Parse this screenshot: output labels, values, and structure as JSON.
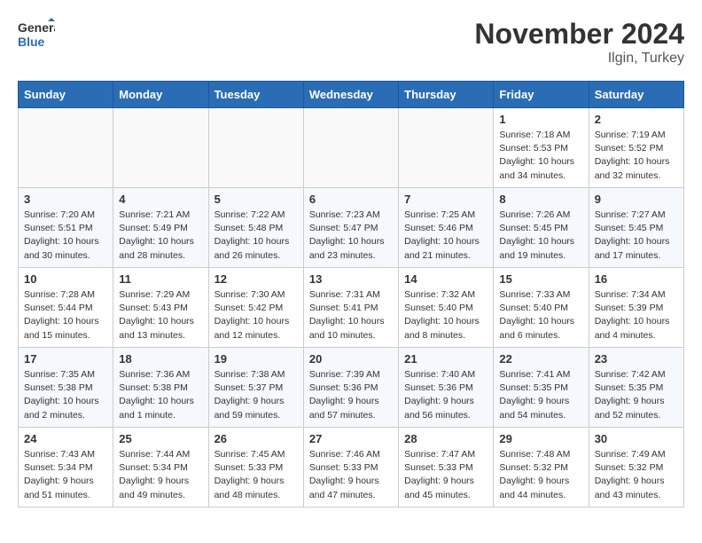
{
  "logo": {
    "line1": "General",
    "line2": "Blue"
  },
  "title": "November 2024",
  "location": "Ilgin, Turkey",
  "days_of_week": [
    "Sunday",
    "Monday",
    "Tuesday",
    "Wednesday",
    "Thursday",
    "Friday",
    "Saturday"
  ],
  "weeks": [
    [
      {
        "day": "",
        "info": ""
      },
      {
        "day": "",
        "info": ""
      },
      {
        "day": "",
        "info": ""
      },
      {
        "day": "",
        "info": ""
      },
      {
        "day": "",
        "info": ""
      },
      {
        "day": "1",
        "info": "Sunrise: 7:18 AM\nSunset: 5:53 PM\nDaylight: 10 hours and 34 minutes."
      },
      {
        "day": "2",
        "info": "Sunrise: 7:19 AM\nSunset: 5:52 PM\nDaylight: 10 hours and 32 minutes."
      }
    ],
    [
      {
        "day": "3",
        "info": "Sunrise: 7:20 AM\nSunset: 5:51 PM\nDaylight: 10 hours and 30 minutes."
      },
      {
        "day": "4",
        "info": "Sunrise: 7:21 AM\nSunset: 5:49 PM\nDaylight: 10 hours and 28 minutes."
      },
      {
        "day": "5",
        "info": "Sunrise: 7:22 AM\nSunset: 5:48 PM\nDaylight: 10 hours and 26 minutes."
      },
      {
        "day": "6",
        "info": "Sunrise: 7:23 AM\nSunset: 5:47 PM\nDaylight: 10 hours and 23 minutes."
      },
      {
        "day": "7",
        "info": "Sunrise: 7:25 AM\nSunset: 5:46 PM\nDaylight: 10 hours and 21 minutes."
      },
      {
        "day": "8",
        "info": "Sunrise: 7:26 AM\nSunset: 5:45 PM\nDaylight: 10 hours and 19 minutes."
      },
      {
        "day": "9",
        "info": "Sunrise: 7:27 AM\nSunset: 5:45 PM\nDaylight: 10 hours and 17 minutes."
      }
    ],
    [
      {
        "day": "10",
        "info": "Sunrise: 7:28 AM\nSunset: 5:44 PM\nDaylight: 10 hours and 15 minutes."
      },
      {
        "day": "11",
        "info": "Sunrise: 7:29 AM\nSunset: 5:43 PM\nDaylight: 10 hours and 13 minutes."
      },
      {
        "day": "12",
        "info": "Sunrise: 7:30 AM\nSunset: 5:42 PM\nDaylight: 10 hours and 12 minutes."
      },
      {
        "day": "13",
        "info": "Sunrise: 7:31 AM\nSunset: 5:41 PM\nDaylight: 10 hours and 10 minutes."
      },
      {
        "day": "14",
        "info": "Sunrise: 7:32 AM\nSunset: 5:40 PM\nDaylight: 10 hours and 8 minutes."
      },
      {
        "day": "15",
        "info": "Sunrise: 7:33 AM\nSunset: 5:40 PM\nDaylight: 10 hours and 6 minutes."
      },
      {
        "day": "16",
        "info": "Sunrise: 7:34 AM\nSunset: 5:39 PM\nDaylight: 10 hours and 4 minutes."
      }
    ],
    [
      {
        "day": "17",
        "info": "Sunrise: 7:35 AM\nSunset: 5:38 PM\nDaylight: 10 hours and 2 minutes."
      },
      {
        "day": "18",
        "info": "Sunrise: 7:36 AM\nSunset: 5:38 PM\nDaylight: 10 hours and 1 minute."
      },
      {
        "day": "19",
        "info": "Sunrise: 7:38 AM\nSunset: 5:37 PM\nDaylight: 9 hours and 59 minutes."
      },
      {
        "day": "20",
        "info": "Sunrise: 7:39 AM\nSunset: 5:36 PM\nDaylight: 9 hours and 57 minutes."
      },
      {
        "day": "21",
        "info": "Sunrise: 7:40 AM\nSunset: 5:36 PM\nDaylight: 9 hours and 56 minutes."
      },
      {
        "day": "22",
        "info": "Sunrise: 7:41 AM\nSunset: 5:35 PM\nDaylight: 9 hours and 54 minutes."
      },
      {
        "day": "23",
        "info": "Sunrise: 7:42 AM\nSunset: 5:35 PM\nDaylight: 9 hours and 52 minutes."
      }
    ],
    [
      {
        "day": "24",
        "info": "Sunrise: 7:43 AM\nSunset: 5:34 PM\nDaylight: 9 hours and 51 minutes."
      },
      {
        "day": "25",
        "info": "Sunrise: 7:44 AM\nSunset: 5:34 PM\nDaylight: 9 hours and 49 minutes."
      },
      {
        "day": "26",
        "info": "Sunrise: 7:45 AM\nSunset: 5:33 PM\nDaylight: 9 hours and 48 minutes."
      },
      {
        "day": "27",
        "info": "Sunrise: 7:46 AM\nSunset: 5:33 PM\nDaylight: 9 hours and 47 minutes."
      },
      {
        "day": "28",
        "info": "Sunrise: 7:47 AM\nSunset: 5:33 PM\nDaylight: 9 hours and 45 minutes."
      },
      {
        "day": "29",
        "info": "Sunrise: 7:48 AM\nSunset: 5:32 PM\nDaylight: 9 hours and 44 minutes."
      },
      {
        "day": "30",
        "info": "Sunrise: 7:49 AM\nSunset: 5:32 PM\nDaylight: 9 hours and 43 minutes."
      }
    ]
  ]
}
